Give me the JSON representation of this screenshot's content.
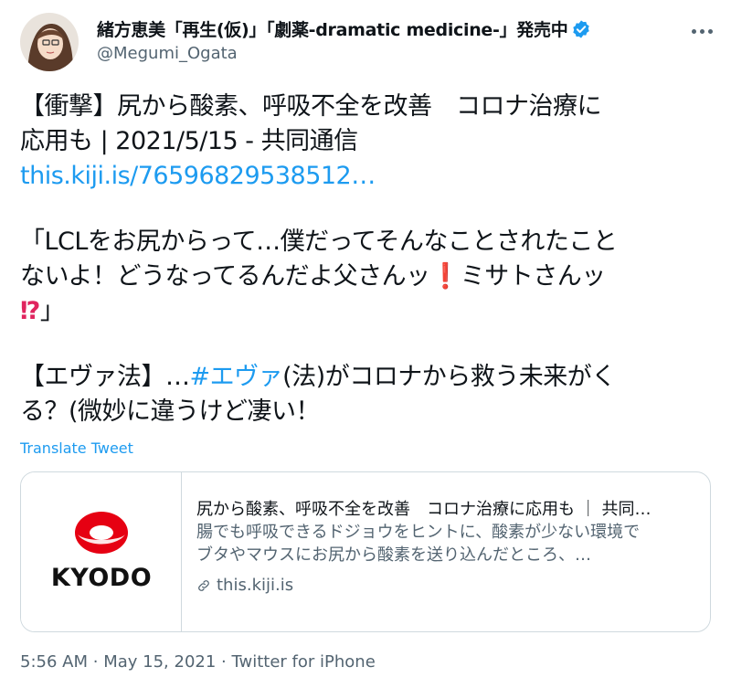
{
  "author": {
    "display_name": "緒方恵美「再生(仮)」「劇薬-dramatic medicine-」発売中",
    "handle": "@Megumi_Ogata"
  },
  "tweet": {
    "line1": "【衝撃】尻から酸素、呼吸不全を改善　コロナ治療に",
    "line2": "応用も | 2021/5/15 - 共同通信",
    "link": "this.kiji.is/76596829538512…",
    "line4": "「LCLをお尻からって…僕だってそんなことされたこと",
    "line5_a": "ないよ！どうなってるんだよ父さんッ",
    "emoji_exclaim": "❗",
    "line5_b": "ミサトさんッ",
    "emoji_interrobang": "⁉",
    "line6_end": "」",
    "line7_a": "【エヴァ法】…",
    "hashtag": "#エヴァ",
    "line7_b": "(法)がコロナから救う未来がく",
    "line8": "る？(微妙に違うけど凄い！"
  },
  "translate_label": "Translate Tweet",
  "card": {
    "logo_text": "KYODO",
    "title": "尻から酸素、呼吸不全を改善　コロナ治療に応用も ｜ 共同…",
    "desc_line1": "腸でも呼吸できるドジョウをヒントに、酸素が少ない環境で",
    "desc_line2": "ブタやマウスにお尻から酸素を送り込んだところ、…",
    "domain": "this.kiji.is"
  },
  "meta": {
    "time": "5:56 AM",
    "date": "May 15, 2021",
    "source": "Twitter for iPhone",
    "separator": "·"
  },
  "colors": {
    "link": "#1d9bf0",
    "verified": "#1d9bf0",
    "emoji_red": "#e0245e",
    "kyodo_red": "#e60012"
  }
}
